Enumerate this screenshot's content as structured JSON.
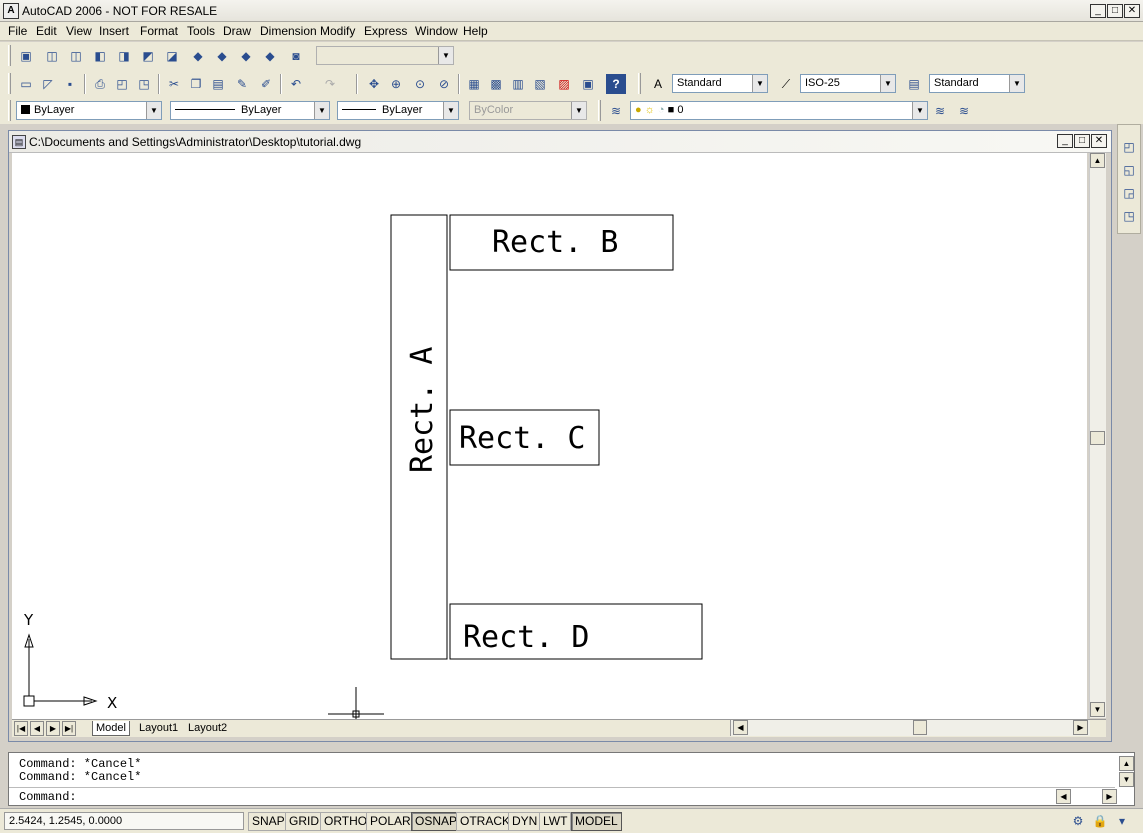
{
  "app": {
    "title": "AutoCAD 2006 - NOT FOR RESALE",
    "icon_label": "A",
    "window_buttons": [
      "_",
      "□",
      "✕"
    ]
  },
  "menu": [
    "File",
    "Edit",
    "View",
    "Insert",
    "Format",
    "Tools",
    "Draw",
    "Dimension",
    "Modify",
    "Express",
    "Window",
    "Help"
  ],
  "toolbars": {
    "text_style": "Standard",
    "dim_style": "ISO-25",
    "table_style": "Standard",
    "color": "ByLayer",
    "linetype": "ByLayer",
    "lineweight": "ByLayer",
    "plot_style": "ByColor",
    "layer": "0"
  },
  "drawing": {
    "title": "C:\\Documents and Settings\\Administrator\\Desktop\\tutorial.dwg",
    "rect_a_label": "Rect. A",
    "rect_b_label": "Rect. B",
    "rect_c_label": "Rect. C",
    "rect_d_label": "Rect. D",
    "ucs_x": "X",
    "ucs_y": "Y"
  },
  "tabs": [
    "Model",
    "Layout1",
    "Layout2"
  ],
  "command": {
    "history": [
      "Command: *Cancel*",
      "Command: *Cancel*"
    ],
    "prompt": "Command:"
  },
  "status": {
    "coordinates": "2.5424, 1.2545, 0.0000",
    "toggles": [
      {
        "label": "SNAP",
        "on": false
      },
      {
        "label": "GRID",
        "on": false
      },
      {
        "label": "ORTHO",
        "on": false
      },
      {
        "label": "POLAR",
        "on": false
      },
      {
        "label": "OSNAP",
        "on": true
      },
      {
        "label": "OTRACK",
        "on": false
      },
      {
        "label": "DYN",
        "on": false
      },
      {
        "label": "LWT",
        "on": false
      },
      {
        "label": "MODEL",
        "on": true
      }
    ]
  }
}
